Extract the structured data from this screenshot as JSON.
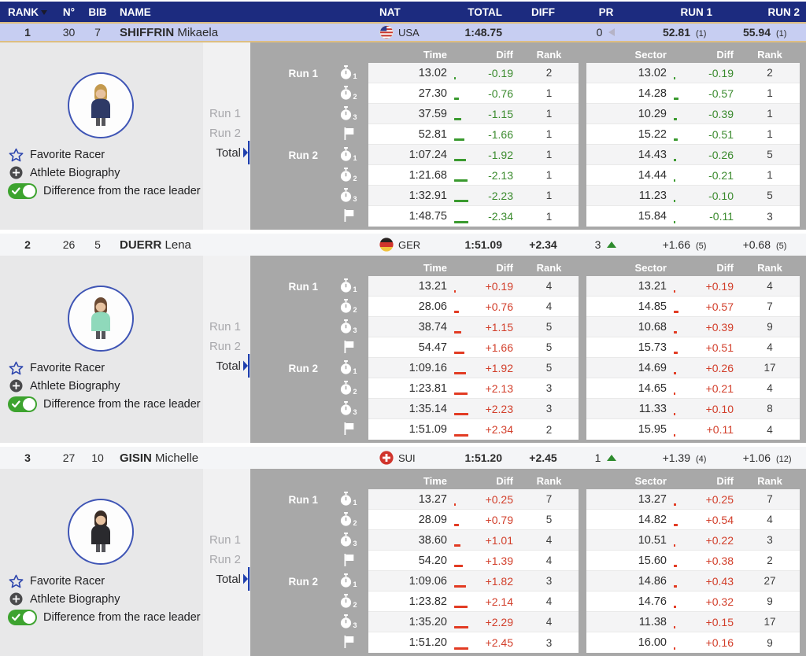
{
  "colors": {
    "header_navy": "#1c2b7f",
    "selected_row_blue": "#c7cef2",
    "selected_row_border_gold": "#ddbe82",
    "panel_gray": "#a8a8a8",
    "left_panel_gray": "#e8e8e9",
    "subnav_gray": "#f1f1f2",
    "diff_negative_green": "#3a8a2d",
    "diff_positive_red": "#d23e2a",
    "toggle_green": "#3da32f",
    "accent_blue": "#2f47ae"
  },
  "table_header": {
    "rank": "RANK",
    "sort_icon": "sort-descending-triangle",
    "n": "N°",
    "bib": "BIB",
    "name": "NAME",
    "nat": "NAT",
    "total": "TOTAL",
    "diff": "DIFF",
    "pr": "PR",
    "run1": "RUN 1",
    "run2": "RUN 2"
  },
  "panel_common": {
    "actions": {
      "favorite": "Favorite Racer",
      "bio": "Athlete Biography",
      "difference": "Difference from the race leader"
    },
    "nav": [
      "Run 1",
      "Run 2",
      "Total"
    ],
    "detail_headers": {
      "time": "Time",
      "diff": "Diff",
      "rank": "Rank",
      "sector": "Sector",
      "diff2": "Diff",
      "rank2": "Rank"
    }
  },
  "racers": [
    {
      "rank": "1",
      "n": "30",
      "bib": "7",
      "last": "SHIFFRIN",
      "first": "Mikaela",
      "nat": "USA",
      "flag": "usa",
      "total": "1:48.75",
      "diff": "",
      "pr": "0",
      "pr_arrow": "left",
      "run1": "52.81",
      "run1_rank": "(1)",
      "run2": "55.94",
      "run2_rank": "(1)",
      "selected": true,
      "avatar": {
        "jacket": "#2e3a66",
        "hair": "#c49a4e"
      },
      "splits": [
        {
          "run": "Run 1",
          "icon": "stopwatch",
          "sub": "1",
          "time": "13.02",
          "tdiff": "-0.19",
          "trank": "2",
          "sector": "13.02",
          "sdiff": "-0.19",
          "srank": "2"
        },
        {
          "icon": "stopwatch",
          "sub": "2",
          "time": "27.30",
          "tdiff": "-0.76",
          "trank": "1",
          "sector": "14.28",
          "sdiff": "-0.57",
          "srank": "1"
        },
        {
          "icon": "stopwatch",
          "sub": "3",
          "time": "37.59",
          "tdiff": "-1.15",
          "trank": "1",
          "sector": "10.29",
          "sdiff": "-0.39",
          "srank": "1"
        },
        {
          "icon": "flag",
          "time": "52.81",
          "tdiff": "-1.66",
          "trank": "1",
          "sector": "15.22",
          "sdiff": "-0.51",
          "srank": "1"
        },
        {
          "run": "Run 2",
          "icon": "stopwatch",
          "sub": "1",
          "time": "1:07.24",
          "tdiff": "-1.92",
          "trank": "1",
          "sector": "14.43",
          "sdiff": "-0.26",
          "srank": "5"
        },
        {
          "icon": "stopwatch",
          "sub": "2",
          "time": "1:21.68",
          "tdiff": "-2.13",
          "trank": "1",
          "sector": "14.44",
          "sdiff": "-0.21",
          "srank": "1"
        },
        {
          "icon": "stopwatch",
          "sub": "3",
          "time": "1:32.91",
          "tdiff": "-2.23",
          "trank": "1",
          "sector": "11.23",
          "sdiff": "-0.10",
          "srank": "5"
        },
        {
          "icon": "flag",
          "time": "1:48.75",
          "tdiff": "-2.34",
          "trank": "1",
          "sector": "15.84",
          "sdiff": "-0.11",
          "srank": "3"
        }
      ]
    },
    {
      "rank": "2",
      "n": "26",
      "bib": "5",
      "last": "DUERR",
      "first": "Lena",
      "nat": "GER",
      "flag": "ger",
      "total": "1:51.09",
      "diff": "+2.34",
      "pr": "3",
      "pr_arrow": "up",
      "run1": "+1.66",
      "run1_rank": "(5)",
      "run2": "+0.68",
      "run2_rank": "(5)",
      "selected": false,
      "avatar": {
        "jacket": "#8fd9bb",
        "hair": "#6b4a33"
      },
      "splits": [
        {
          "run": "Run 1",
          "icon": "stopwatch",
          "sub": "1",
          "time": "13.21",
          "tdiff": "+0.19",
          "trank": "4",
          "sector": "13.21",
          "sdiff": "+0.19",
          "srank": "4"
        },
        {
          "icon": "stopwatch",
          "sub": "2",
          "time": "28.06",
          "tdiff": "+0.76",
          "trank": "4",
          "sector": "14.85",
          "sdiff": "+0.57",
          "srank": "7"
        },
        {
          "icon": "stopwatch",
          "sub": "3",
          "time": "38.74",
          "tdiff": "+1.15",
          "trank": "5",
          "sector": "10.68",
          "sdiff": "+0.39",
          "srank": "9"
        },
        {
          "icon": "flag",
          "time": "54.47",
          "tdiff": "+1.66",
          "trank": "5",
          "sector": "15.73",
          "sdiff": "+0.51",
          "srank": "4"
        },
        {
          "run": "Run 2",
          "icon": "stopwatch",
          "sub": "1",
          "time": "1:09.16",
          "tdiff": "+1.92",
          "trank": "5",
          "sector": "14.69",
          "sdiff": "+0.26",
          "srank": "17"
        },
        {
          "icon": "stopwatch",
          "sub": "2",
          "time": "1:23.81",
          "tdiff": "+2.13",
          "trank": "3",
          "sector": "14.65",
          "sdiff": "+0.21",
          "srank": "4"
        },
        {
          "icon": "stopwatch",
          "sub": "3",
          "time": "1:35.14",
          "tdiff": "+2.23",
          "trank": "3",
          "sector": "11.33",
          "sdiff": "+0.10",
          "srank": "8"
        },
        {
          "icon": "flag",
          "time": "1:51.09",
          "tdiff": "+2.34",
          "trank": "2",
          "sector": "15.95",
          "sdiff": "+0.11",
          "srank": "4"
        }
      ]
    },
    {
      "rank": "3",
      "n": "27",
      "bib": "10",
      "last": "GISIN",
      "first": "Michelle",
      "nat": "SUI",
      "flag": "sui",
      "total": "1:51.20",
      "diff": "+2.45",
      "pr": "1",
      "pr_arrow": "up",
      "run1": "+1.39",
      "run1_rank": "(4)",
      "run2": "+1.06",
      "run2_rank": "(12)",
      "selected": false,
      "avatar": {
        "jacket": "#2a2a2e",
        "hair": "#3a2d26"
      },
      "splits": [
        {
          "run": "Run 1",
          "icon": "stopwatch",
          "sub": "1",
          "time": "13.27",
          "tdiff": "+0.25",
          "trank": "7",
          "sector": "13.27",
          "sdiff": "+0.25",
          "srank": "7"
        },
        {
          "icon": "stopwatch",
          "sub": "2",
          "time": "28.09",
          "tdiff": "+0.79",
          "trank": "5",
          "sector": "14.82",
          "sdiff": "+0.54",
          "srank": "4"
        },
        {
          "icon": "stopwatch",
          "sub": "3",
          "time": "38.60",
          "tdiff": "+1.01",
          "trank": "4",
          "sector": "10.51",
          "sdiff": "+0.22",
          "srank": "3"
        },
        {
          "icon": "flag",
          "time": "54.20",
          "tdiff": "+1.39",
          "trank": "4",
          "sector": "15.60",
          "sdiff": "+0.38",
          "srank": "2"
        },
        {
          "run": "Run 2",
          "icon": "stopwatch",
          "sub": "1",
          "time": "1:09.06",
          "tdiff": "+1.82",
          "trank": "3",
          "sector": "14.86",
          "sdiff": "+0.43",
          "srank": "27"
        },
        {
          "icon": "stopwatch",
          "sub": "2",
          "time": "1:23.82",
          "tdiff": "+2.14",
          "trank": "4",
          "sector": "14.76",
          "sdiff": "+0.32",
          "srank": "9"
        },
        {
          "icon": "stopwatch",
          "sub": "3",
          "time": "1:35.20",
          "tdiff": "+2.29",
          "trank": "4",
          "sector": "11.38",
          "sdiff": "+0.15",
          "srank": "17"
        },
        {
          "icon": "flag",
          "time": "1:51.20",
          "tdiff": "+2.45",
          "trank": "3",
          "sector": "16.00",
          "sdiff": "+0.16",
          "srank": "9"
        }
      ]
    }
  ]
}
